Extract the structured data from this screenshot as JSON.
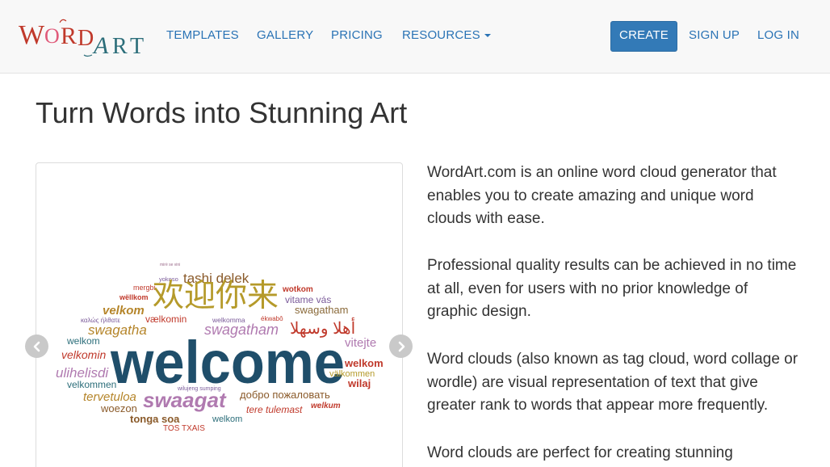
{
  "brand": {
    "logo_letters": [
      "W",
      "O",
      "R",
      "D",
      "A",
      "R",
      "T"
    ],
    "colors": {
      "red": "#c0392b",
      "pink": "#e05a7a",
      "teal": "#2c6e7a",
      "nav": "#2a73b5",
      "button": "#337ab7"
    }
  },
  "nav": {
    "templates": "TEMPLATES",
    "gallery": "GALLERY",
    "pricing": "PRICING",
    "resources": "RESOURCES",
    "create": "CREATE",
    "sign_up": "SIGN UP",
    "log_in": "LOG IN"
  },
  "page": {
    "title": "Turn Words into Stunning Art",
    "paragraphs": [
      "WordArt.com is an online word cloud generator that enables you to create amazing and unique word clouds with ease.",
      "Professional quality results can be achieved in no time at all, even for users with no prior knowledge of graphic design.",
      "Word clouds (also known as tag cloud, word collage or wordle) are visual representation of text that give greater rank to words that appear more frequently.",
      "Word clouds are perfect for creating stunning"
    ]
  },
  "carousel": {
    "prev_icon": "chevron-left-icon",
    "next_icon": "chevron-right-icon",
    "cloud_words": {
      "main": "welcome",
      "w01": "欢迎你来",
      "w02": "tashi delek",
      "w03": "swaagat",
      "w04": "أهلا وسهلا",
      "w05": "swagatham",
      "w06": "swagatham",
      "w07": "swagatha",
      "w08": "velkom",
      "w09": "welkom",
      "w10": "velkomin",
      "w11": "ulihelisdi",
      "w12": "tervetuloa",
      "w13": "woezon",
      "w14": "tonga soa",
      "w15": "TOS TXAIS",
      "w16": "welkom",
      "w17": "добро пожаловать",
      "w18": "tere tulemast",
      "w19": "welkum",
      "w20": "wilaj",
      "w21": "välkommen",
      "w22": "welkom",
      "w23": "vitejte",
      "w24": "vitame vás",
      "w25": "wotkom",
      "w26": "vælkomin",
      "w27": "welkomma",
      "w28": "mergbi",
      "w29": "wëllkom",
      "w30": "yokoso",
      "w31": "velkommen",
      "w32": "wilujeng sumping",
      "w33": "καλώς ήλθατε",
      "w34": "ékwabô",
      "w35": "mirë se vini"
    }
  }
}
